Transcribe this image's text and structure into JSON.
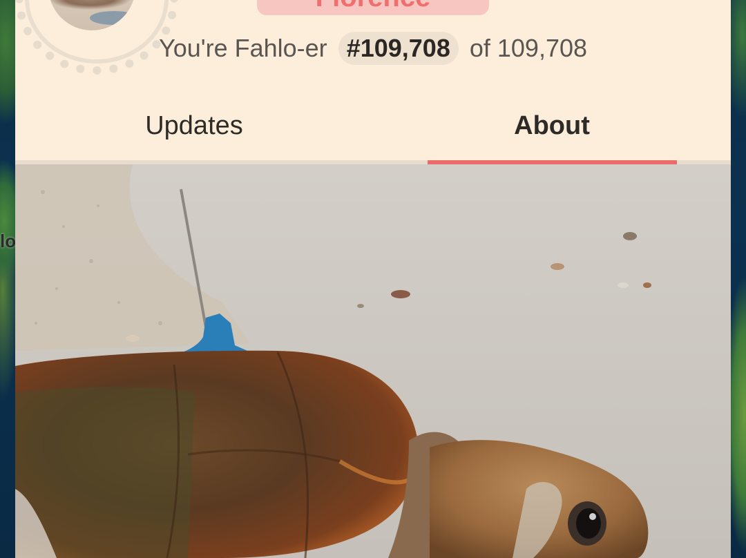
{
  "map": {
    "partial_label": "lo"
  },
  "profile": {
    "name_partial": "Florence",
    "rank_prefix": "You're Fahlo-er",
    "rank_number": "#109,708",
    "rank_suffix": "of 109,708"
  },
  "tabs": [
    {
      "label": "Updates",
      "active": false
    },
    {
      "label": "About",
      "active": true
    }
  ],
  "colors": {
    "accent": "#ea6b6b",
    "card_bg": "#fdeedb",
    "name_pill": "#f7c6c1"
  },
  "photo": {
    "subject": "turtle-with-satellite-tag-photo"
  }
}
